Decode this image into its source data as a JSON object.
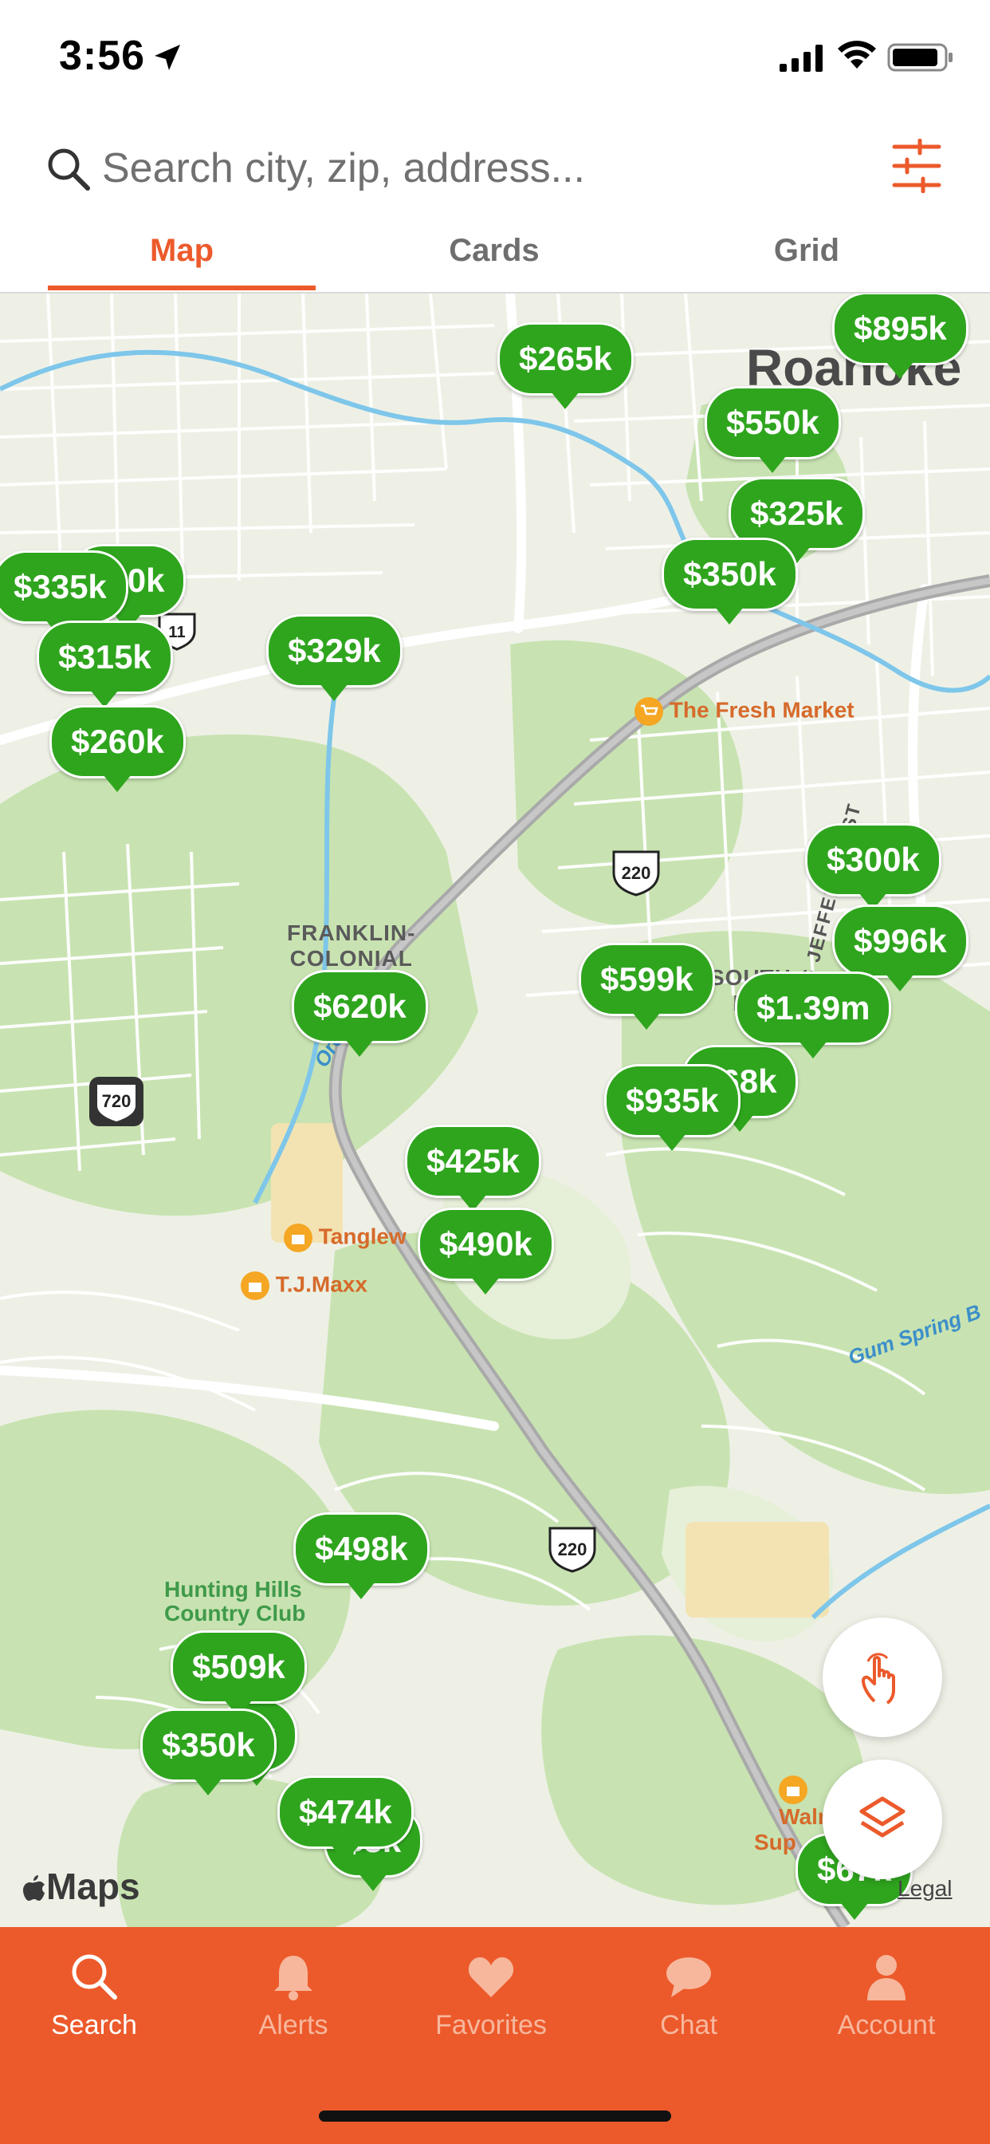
{
  "status_bar": {
    "time": "3:56"
  },
  "search": {
    "placeholder": "Search city, zip, address..."
  },
  "tabs": [
    {
      "label": "Map",
      "active": true
    },
    {
      "label": "Cards",
      "active": false
    },
    {
      "label": "Grid",
      "active": false
    }
  ],
  "map": {
    "city": "Roanoke",
    "area_label": "FRANKLIN-\nCOLONIAL",
    "area_label_2": "SOUTH\nRO",
    "pois": {
      "fresh_market": "The Fresh Market",
      "tanglewood": "Tanglew",
      "tjmaxx": "T.J.Maxx",
      "walmart": "Walmart\nSup",
      "hunting_hills": "Hunting Hills\nCountry Club"
    },
    "roads": {
      "jefferson": "S JEFFERSON ST",
      "gum_spring": "Gum Spring B",
      "ore_branch": "Ore Bran"
    },
    "shields": {
      "us220_a": "220",
      "us220_b": "220",
      "i720": "720",
      "r11": "11"
    },
    "markers": [
      "$265k",
      "$895k",
      "$550k",
      "$325k",
      "$350k",
      "$30k",
      "$335k",
      "$315k",
      "$260k",
      "$329k",
      "$300k",
      "$996k",
      "$599k",
      "$1.39m",
      "$68k",
      "$935k",
      "$620k",
      "$425k",
      "$490k",
      "$498k",
      "$509k",
      "$k",
      "$350k",
      "$474k",
      "$3k",
      "$67k"
    ],
    "attribution": "Maps",
    "legal": "Legal"
  },
  "bottom_nav": [
    {
      "label": "Search",
      "icon": "search-icon",
      "active": true
    },
    {
      "label": "Alerts",
      "icon": "bell-icon",
      "active": false
    },
    {
      "label": "Favorites",
      "icon": "heart-icon",
      "active": false
    },
    {
      "label": "Chat",
      "icon": "chat-bubble-icon",
      "active": false
    },
    {
      "label": "Account",
      "icon": "person-icon",
      "active": false
    }
  ],
  "colors": {
    "accent": "#ec5a2b",
    "marker": "#2fa51e"
  }
}
